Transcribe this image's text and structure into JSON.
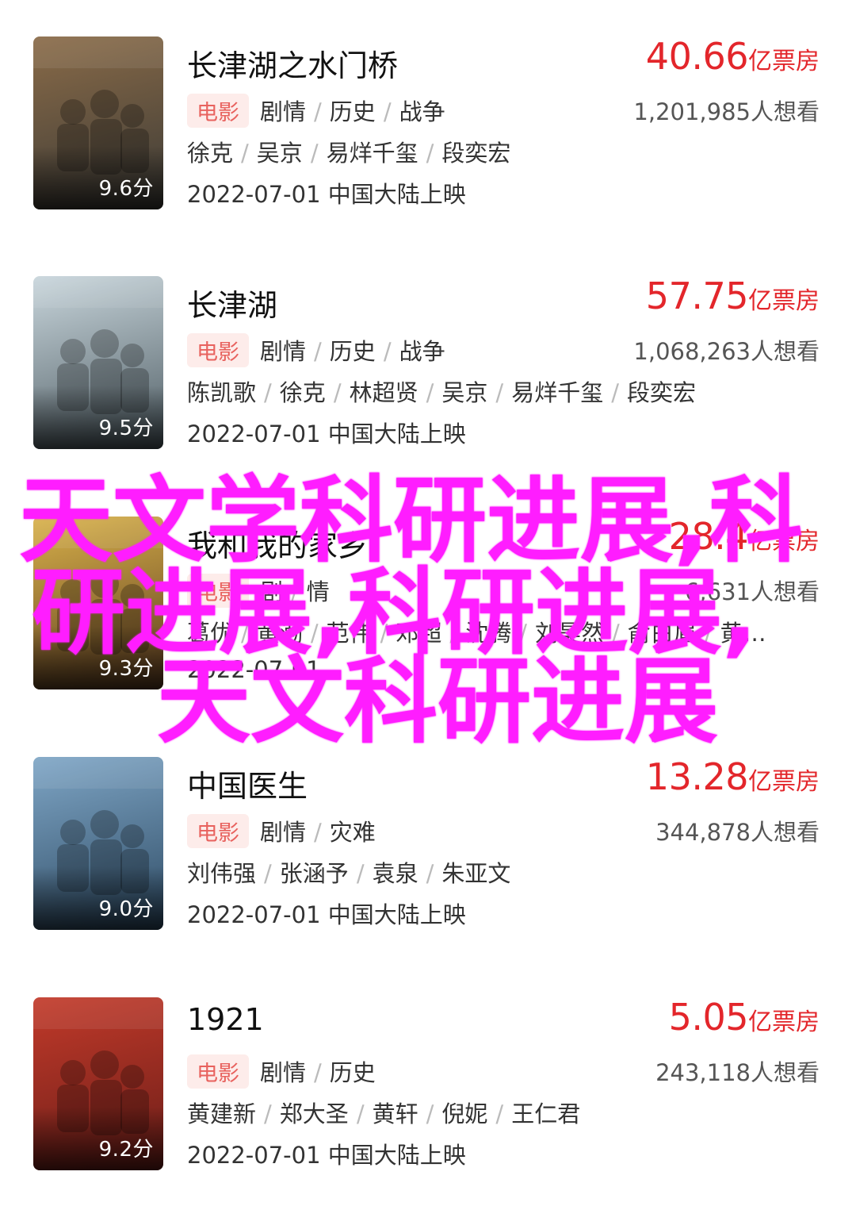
{
  "movies": [
    {
      "title": "长津湖之水门桥",
      "score": "9.6分",
      "box_num": "40.66",
      "box_unit": "亿票房",
      "want": "1,201,985人想看",
      "tag": "电影",
      "genres": [
        "剧情",
        "历史",
        "战争"
      ],
      "cast": [
        "徐克",
        "吴京",
        "易烊千玺",
        "段奕宏"
      ],
      "date": "2022-07-01 中国大陆上映",
      "poster_colors": [
        "#8a6b48",
        "#3b3a36"
      ]
    },
    {
      "title": "长津湖",
      "score": "9.5分",
      "box_num": "57.75",
      "box_unit": "亿票房",
      "want": "1,068,263人想看",
      "tag": "电影",
      "genres": [
        "剧情",
        "历史",
        "战争"
      ],
      "cast": [
        "陈凯歌",
        "徐克",
        "林超贤",
        "吴京",
        "易烊千玺",
        "段奕宏"
      ],
      "date": "2022-07-01 中国大陆上映",
      "poster_colors": [
        "#c9d6dc",
        "#4e5c63"
      ]
    },
    {
      "title": "我和我的家乡",
      "score": "9.3分",
      "box_num": "28.4",
      "box_unit": "亿票房",
      "want": "6,631人想看",
      "tag": "电影",
      "genres": [
        "剧",
        "情"
      ],
      "cast": [
        "葛优",
        "黄渤",
        "范伟",
        "邓超",
        "沈腾",
        "刘昊然",
        "俞白眉",
        "黄…"
      ],
      "date": "2022-07-01",
      "poster_colors": [
        "#d9b24a",
        "#5a3a20"
      ]
    },
    {
      "title": "中国医生",
      "score": "9.0分",
      "box_num": "13.28",
      "box_unit": "亿票房",
      "want": "344,878人想看",
      "tag": "电影",
      "genres": [
        "剧情",
        "灾难"
      ],
      "cast": [
        "刘伟强",
        "张涵予",
        "袁泉",
        "朱亚文"
      ],
      "date": "2022-07-01 中国大陆上映",
      "poster_colors": [
        "#7fa6c6",
        "#2d4a63"
      ]
    },
    {
      "title": "1921",
      "score": "9.2分",
      "box_num": "5.05",
      "box_unit": "亿票房",
      "want": "243,118人想看",
      "tag": "电影",
      "genres": [
        "剧情",
        "历史"
      ],
      "cast": [
        "黄建新",
        "郑大圣",
        "黄轩",
        "倪妮",
        "王仁君"
      ],
      "date": "2022-07-01 中国大陆上映",
      "poster_colors": [
        "#c23a2a",
        "#6a1d18"
      ]
    }
  ],
  "watermark": {
    "line1": "天文学科研进展,科",
    "line2": "研进展,科研进展,",
    "line3": "天文科研进展"
  }
}
